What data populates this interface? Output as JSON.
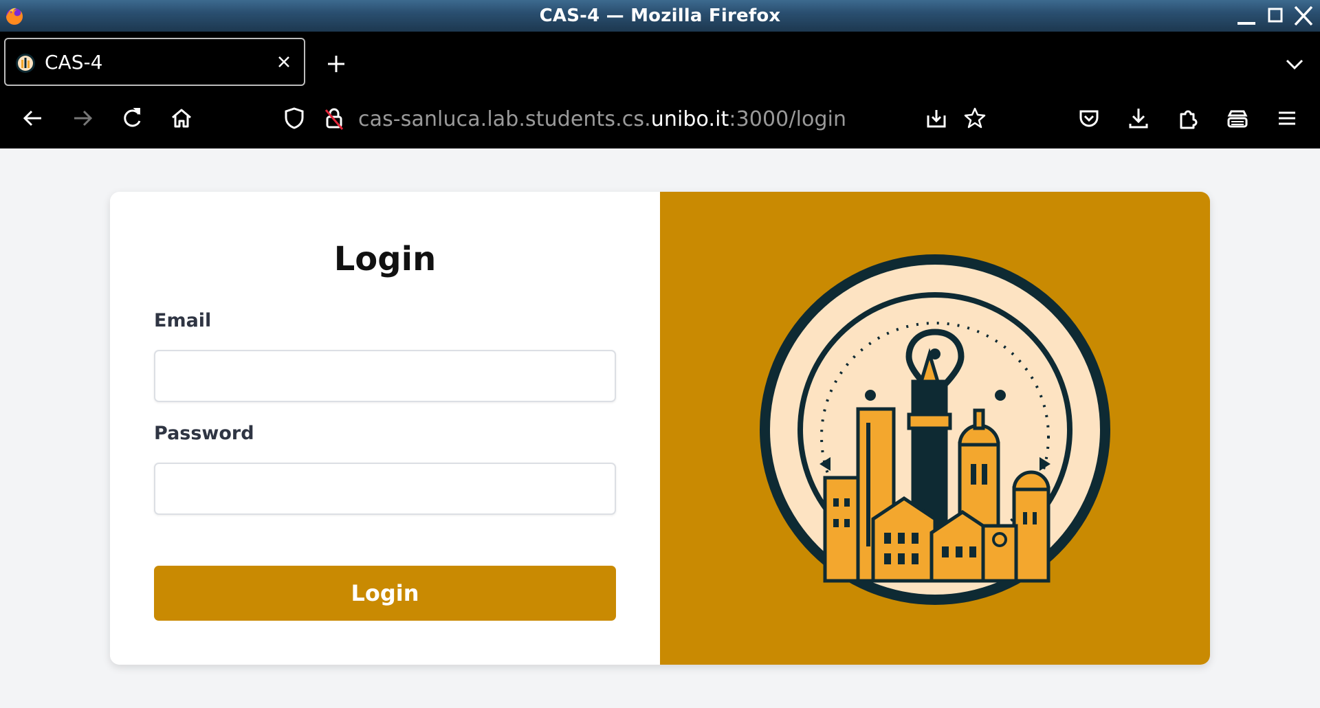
{
  "window": {
    "title": "CAS-4 — Mozilla Firefox"
  },
  "tabs": [
    {
      "title": "CAS-4"
    }
  ],
  "address": {
    "prefix": "cas-sanluca.lab.students.cs.",
    "domain": "unibo.it",
    "suffix": ":3000/login"
  },
  "form": {
    "heading": "Login",
    "email_label": "Email",
    "email_value": "",
    "password_label": "Password",
    "password_value": "",
    "submit_label": "Login"
  },
  "colors": {
    "accent": "#c98a02",
    "page_bg": "#f3f4f6",
    "logo_dark": "#0e2a33",
    "logo_cream": "#fde3c2",
    "logo_orange": "#f3a72e"
  },
  "icons": {
    "titlebar": [
      "firefox-icon",
      "minimize-icon",
      "maximize-icon",
      "close-icon"
    ],
    "nav": [
      "back-icon",
      "forward-icon",
      "reload-icon",
      "home-icon",
      "shield-icon",
      "insecure-lock-icon",
      "page-action-icon",
      "bookmark-star-icon",
      "pocket-icon",
      "downloads-icon",
      "extensions-icon",
      "private-icon",
      "menu-icon"
    ]
  }
}
